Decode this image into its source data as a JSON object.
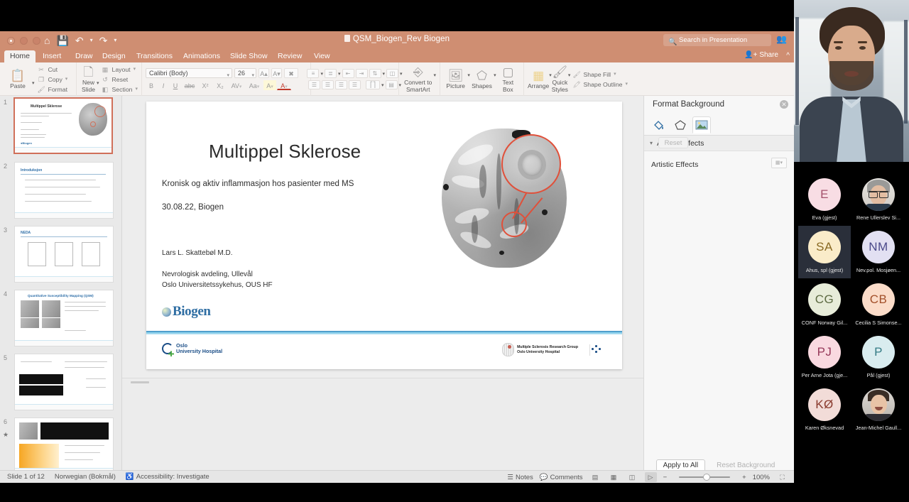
{
  "window": {
    "doc_title": "QSM_Biogen_Rev Biogen",
    "search_placeholder": "Search in Presentation",
    "share_label": "Share",
    "quick_access": [
      "home-icon",
      "save-icon",
      "undo-icon",
      "redo-icon",
      "customize-icon"
    ]
  },
  "ribbon": {
    "tabs": [
      {
        "label": "Home",
        "active": true
      },
      {
        "label": "Insert",
        "active": false
      },
      {
        "label": "Draw",
        "active": false
      },
      {
        "label": "Design",
        "active": false
      },
      {
        "label": "Transitions",
        "active": false
      },
      {
        "label": "Animations",
        "active": false
      },
      {
        "label": "Slide Show",
        "active": false
      },
      {
        "label": "Review",
        "active": false
      },
      {
        "label": "View",
        "active": false
      }
    ],
    "clipboard": {
      "paste": "Paste",
      "cut": "Cut",
      "copy": "Copy",
      "format": "Format"
    },
    "slides": {
      "new_slide": "New\nSlide",
      "new_slide_line1": "New",
      "new_slide_line2": "Slide",
      "layout": "Layout",
      "reset": "Reset",
      "section": "Section"
    },
    "font": {
      "family": "Calibri (Body)",
      "size": "26",
      "grow": "A",
      "shrink": "A",
      "clear": "A",
      "bold": "B",
      "italic": "I",
      "underline": "U",
      "strike": "abc",
      "superscript": "X²",
      "subscript": "X₂",
      "spacing": "AV",
      "case": "Aa",
      "highlight": "A",
      "color": "A"
    },
    "drawing": {
      "convert_smartart_l1": "Convert to",
      "convert_smartart_l2": "SmartArt",
      "picture": "Picture",
      "shapes": "Shapes",
      "textbox_l1": "Text",
      "textbox_l2": "Box",
      "arrange": "Arrange",
      "quick_styles_l1": "Quick",
      "quick_styles_l2": "Styles",
      "shape_fill": "Shape Fill",
      "shape_outline": "Shape Outline"
    }
  },
  "thumbnails": [
    {
      "number": "1",
      "title": "Multippel Sklerose",
      "selected": true,
      "starred": false
    },
    {
      "number": "2",
      "title": "Introduksjon",
      "selected": false,
      "starred": false
    },
    {
      "number": "3",
      "title": "NEDA",
      "selected": false,
      "starred": false
    },
    {
      "number": "4",
      "title": "Quantitative Susceptibility Mapping (QSM)",
      "selected": false,
      "starred": false
    },
    {
      "number": "5",
      "title": "",
      "selected": false,
      "starred": false
    },
    {
      "number": "6",
      "title": "",
      "selected": false,
      "starred": true
    }
  ],
  "slide": {
    "title": "Multippel Sklerose",
    "subtitle": "Kronisk og aktiv inflammasjon hos pasienter med MS",
    "date_line": "30.08.22, Biogen",
    "author": "Lars L. Skattebøl M.D.",
    "affiliation_1": "Nevrologisk avdeling, Ullevål",
    "affiliation_2": "Oslo Universitetssykehus, OUS HF",
    "biogen_logo_text": "Biogen",
    "footer_logo_1_line1": "Oslo",
    "footer_logo_1_line2": "University Hospital",
    "footer_logo_2_line1": "Multiple Sclerosis Research Group",
    "footer_logo_2_line2": "Oslo University Hospital",
    "image_alt": "brain-mri-qsm-image"
  },
  "pane": {
    "title": "Format Background",
    "tabs": [
      "fill-icon",
      "shape-icon",
      "picture-icon"
    ],
    "active_tab_index": 2,
    "section_label": "Artistic Effects",
    "effect_label": "Artistic Effects",
    "reset_label": "Reset",
    "apply_to_all": "Apply to All",
    "reset_background": "Reset Background"
  },
  "statusbar": {
    "slide_counter": "Slide 1 of 12",
    "language": "Norwegian (Bokmål)",
    "accessibility": "Accessibility: Investigate",
    "notes": "Notes",
    "comments": "Comments",
    "zoom_level": "100%",
    "zoom_minus": "−",
    "zoom_plus": "+",
    "views": [
      "normal-view",
      "slide-sorter-view",
      "reading-view",
      "slideshow-view"
    ],
    "active_view_index": 3
  },
  "video": {
    "self_label": "",
    "participants": [
      {
        "initials": "E",
        "name": "Eva (gjest)",
        "bg": "#f8dde4",
        "fg": "#a4516b",
        "photo": false,
        "active": false
      },
      {
        "initials": "",
        "name": "Rene Ullerslev Si...",
        "bg": "#ddd8d2",
        "fg": "#333333",
        "photo": true,
        "photo_style": "p1",
        "active": false
      },
      {
        "initials": "SA",
        "name": "Ahus, spl (gjest)",
        "bg": "#faecc9",
        "fg": "#8a6a23",
        "photo": false,
        "active": true
      },
      {
        "initials": "NM",
        "name": "Nev.pol. Mosjøen...",
        "bg": "#e2e0f2",
        "fg": "#4b4a8a",
        "photo": false,
        "active": false
      },
      {
        "initials": "CG",
        "name": "CONF Norway Gil...",
        "bg": "#e7ecd9",
        "fg": "#5d6b43",
        "photo": false,
        "active": false
      },
      {
        "initials": "CB",
        "name": "Cecilia S Simonse...",
        "bg": "#fbdcc9",
        "fg": "#a3502a",
        "photo": false,
        "active": false
      },
      {
        "initials": "PJ",
        "name": "Per Arne Jota (gje...",
        "bg": "#f9d9e0",
        "fg": "#96395a",
        "photo": false,
        "active": false
      },
      {
        "initials": "P",
        "name": "Pål (gjest)",
        "bg": "#d9ecef",
        "fg": "#357b85",
        "photo": false,
        "active": false
      },
      {
        "initials": "KØ",
        "name": "Karen Øksnevad",
        "bg": "#f2dcd8",
        "fg": "#8a3b2e",
        "photo": false,
        "active": false
      },
      {
        "initials": "",
        "name": "Jean-Michel Gaull...",
        "bg": "#ddd8d2",
        "fg": "#333333",
        "photo": true,
        "photo_style": "p2",
        "active": false
      }
    ]
  },
  "colors": {
    "ribbon_accent": "#cf8e72",
    "selection_border": "#d0705a",
    "brain_annotation": "#e0503a",
    "biogen_blue": "#2f6ea3",
    "slide_rule_blue": "#2d7fb8"
  }
}
